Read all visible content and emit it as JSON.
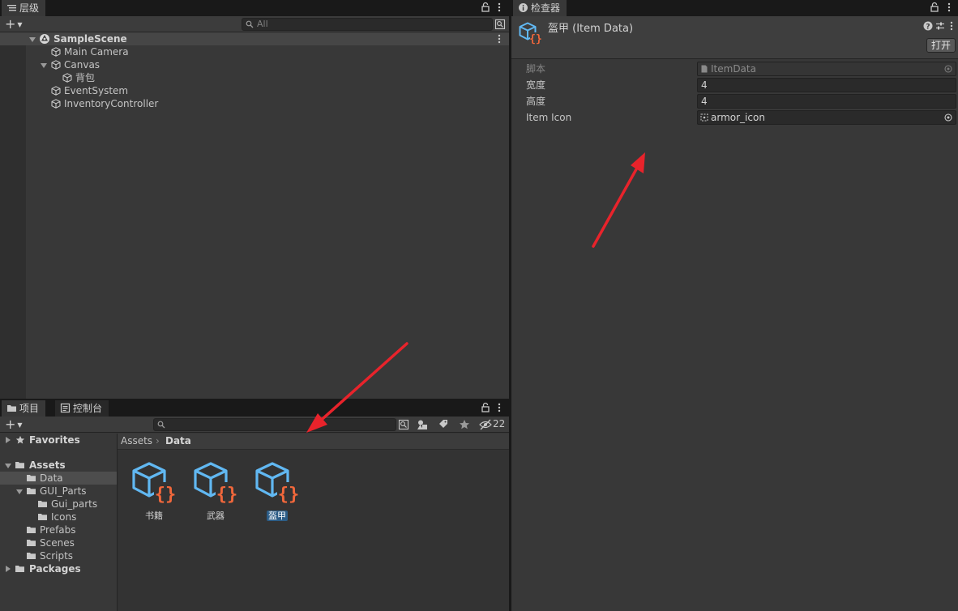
{
  "hierarchy": {
    "tab_label": "层级",
    "search_placeholder": "All",
    "items": [
      {
        "label": "SampleScene"
      },
      {
        "label": "Main Camera"
      },
      {
        "label": "Canvas"
      },
      {
        "label": "背包"
      },
      {
        "label": "EventSystem"
      },
      {
        "label": "InventoryController"
      }
    ]
  },
  "inspector": {
    "tab_label": "检查器",
    "object_title": "盔甲 (Item Data)",
    "open_button": "打开",
    "fields": [
      {
        "label": "脚本",
        "value": "ItemData"
      },
      {
        "label": "宽度",
        "value": "4"
      },
      {
        "label": "高度",
        "value": "4"
      },
      {
        "label": "Item Icon",
        "value": "armor_icon"
      }
    ]
  },
  "project": {
    "tab_label": "项目",
    "console_tab_label": "控制台",
    "hidden_count": "22",
    "breadcrumb": [
      "Assets",
      "Data"
    ],
    "tree": [
      {
        "label": "Favorites"
      },
      {
        "label": "Assets"
      },
      {
        "label": "Data"
      },
      {
        "label": "GUI_Parts"
      },
      {
        "label": "Gui_parts"
      },
      {
        "label": "Icons"
      },
      {
        "label": "Prefabs"
      },
      {
        "label": "Scenes"
      },
      {
        "label": "Scripts"
      },
      {
        "label": "Packages"
      }
    ],
    "assets": [
      {
        "label": "书籍"
      },
      {
        "label": "武器"
      },
      {
        "label": "盔甲"
      }
    ]
  },
  "colors": {
    "accent_selection": "#2c5d87",
    "cube_blue": "#61b8f2",
    "braces_orange": "#f0673b",
    "annotation_arrow": "#e8232b"
  }
}
